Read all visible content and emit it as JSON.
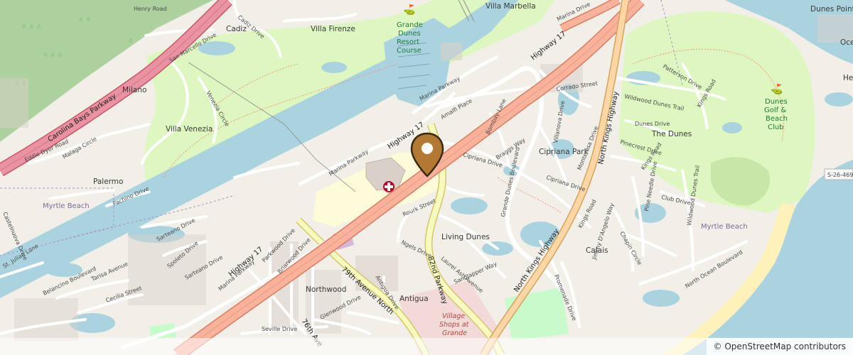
{
  "map": {
    "attribution": "© OpenStreetMap contributors",
    "colors": {
      "land": "#f2efe9",
      "water": "#aad3df",
      "park": "#c8facc",
      "golf": "#def6c0",
      "forest": "#add19e",
      "motorway": "#e892a2",
      "trunk": "#f9b29c",
      "primary": "#fcd6a4",
      "secondary": "#f7fabf",
      "hospital_area": "#fdfbd8",
      "commercial": "#f2dad9",
      "residential": "#e0dfdf",
      "beach": "#fff1ba",
      "pin": "#b17932"
    },
    "pin_icon": "map-marker-icon"
  },
  "labels": {
    "henry_road": "Henry Road",
    "carolina_bays_parkway": "Carolina Bays Parkway",
    "cadiz_drive": "Cadiz Drive",
    "cadiz": "Cadiz",
    "villa_firenze": "Villa Firenze",
    "grande_dunes_resort_course": [
      "Grande",
      "Dunes",
      "Resort",
      "Course"
    ],
    "villa_marbella": "Villa Marbella",
    "marina_drive": "Marina Drive",
    "dunes_pointe": "Dunes Pointe",
    "san_marcello_drive": "San Marcello Drive",
    "milano": "Milano",
    "venezia_circle": "Venezia Circle",
    "villa_venezia": "Villa Venezia",
    "eddie_dyer_road": "Eddie Dyer Road",
    "malaga_circle": "Malaga Circle",
    "palermo": "Palermo",
    "pachino_drive": "Pachino Drive",
    "myrtle_beach_west": "Myrtle Beach",
    "marina_parkway_top": "Marina Parkway",
    "amalfi_place": "Amalfi Place",
    "highway_17_top": "Highway 17",
    "highway_17_mid": "Highway 17",
    "highway_17_low": "Highway 17",
    "marina_parkway_mid": "Marina Parkway",
    "marina_parkway_low": "Marina Parkway",
    "corrado_street": "Corrado Street",
    "north_kings_highway": "North Kings Highway",
    "north_kings_highway_low": "North Kings Highway",
    "patterson_drive": "Patterson Drive",
    "wildwood_dunes_trail": "Wildwood Dunes Trail",
    "kings_road": "Kings Road",
    "dunes_drive": "Dunes Drive",
    "the_dunes": "The Dunes",
    "dunes_golf_beach_club": [
      "Dunes",
      "Golf &",
      "Beach",
      "Club"
    ],
    "bombay_lane": "Bombay Lane",
    "braggs_way": "Braggs Way",
    "cipriana_drive": "Cipriana Drive",
    "cipriana_park": "Cipriana Park",
    "villanova_drive": "Villanova Drive",
    "monterosa_drive": "Monterosa Drive",
    "grande_dunes_boulevard": "Grande Dunes Boulevard",
    "cipriana_drive_low": "Cipriana Drive",
    "pinecrest_drive": "Pinecrest Drive",
    "kings_road_2": "Kings Road",
    "pine_needle_drive": "Pine Needle Drive",
    "club_drive": "Club Drive",
    "wildwood_dunes_trail_2": "Wildwood Dunes Trail",
    "s26": "S-26-469",
    "myrtle_beach_east": "Myrtle Beach",
    "rourk_street": "Rourk Street",
    "living_dunes": "Living Dunes",
    "ngels_drive": "Ngels Drive",
    "laurel_ash_avenue": "Laurel Ash Avenue",
    "sandlapper_way": "Sandlapper Way",
    "parkway_82nd": "82nd Parkway",
    "kings_road_3": "Kings Road",
    "jimmy_dangelo_way": "Jimmy D'Angelo Way",
    "calais": "Calais",
    "chapin_circle": "Chapin Circle",
    "promenade_drive": "Promenade Drive",
    "north_ocean_boulevard": "North Ocean Boulevard",
    "sarteano_drive_top": "Sarteano Drive",
    "spoleto_drive": "Spoleto Drive",
    "sarteano_drive": "Sarteano Drive",
    "st_julian_lane": "St. Julian Lane",
    "castelnuova_drive": "Castelnuova Drive",
    "tarisa_avenue": "Tarisa Avenue",
    "belancino_boulevard": "Belancino Boulevard",
    "cecilia_street": "Cecilia Street",
    "parkwood_drive": "Parkwood Drive",
    "briarwood_drive": "Briarwood Drive",
    "northwood": "Northwood",
    "avenue_79th": "79th Avenue North",
    "antigua_drive": "Antigua Drive",
    "antigua": "Antigua",
    "glenwood_drive": "Glenwood Drive",
    "coteswood_drive": "Coteswood Drive",
    "avenue_76th": "76th Ave",
    "seville_drive": "Seville Drive",
    "village_shops": [
      "Village",
      "Shops at",
      "Grande"
    ],
    "corrado": "Corrado",
    "marina_top_right": "Marina Drive",
    "ocean_label": "Oce",
    "he_label": "He"
  }
}
